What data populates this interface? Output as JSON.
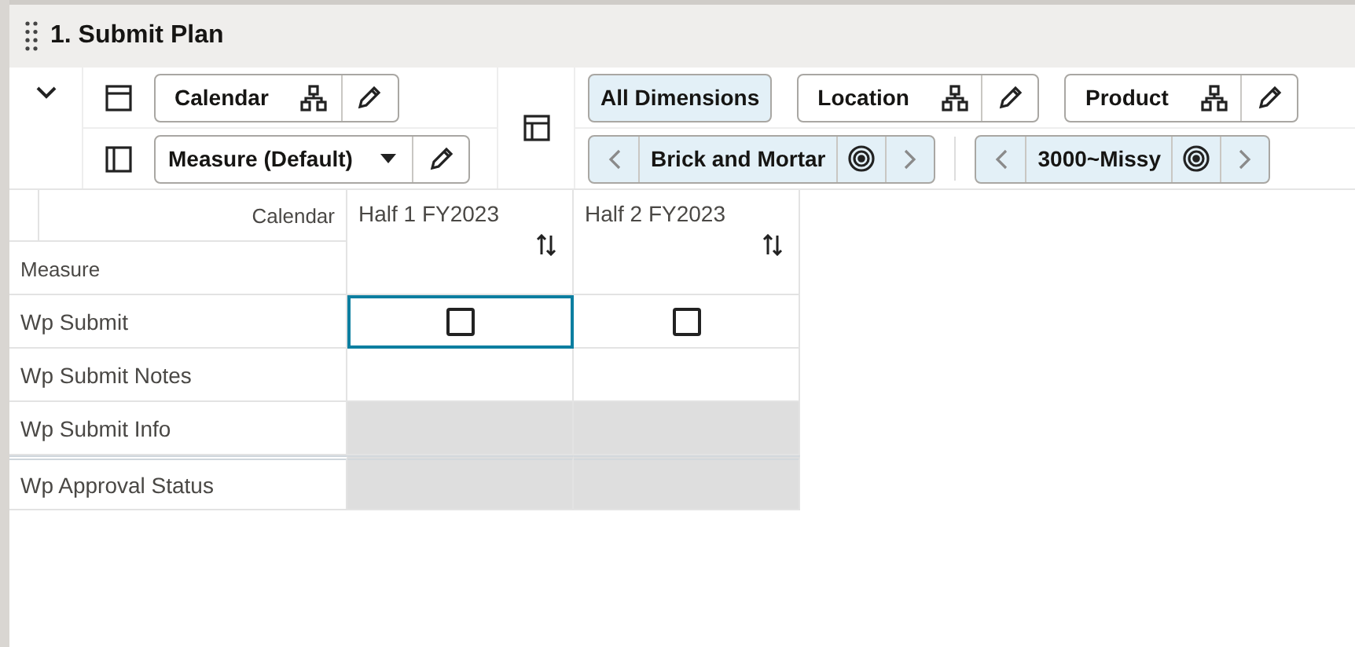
{
  "panel": {
    "title": "1. Submit Plan"
  },
  "toolbar": {
    "expanded": false,
    "column_tiles": [
      {
        "label": "Calendar",
        "kind": "hierarchy"
      }
    ],
    "row_tiles": [
      {
        "label": "Measure (Default)",
        "kind": "dropdown"
      }
    ],
    "all_dimensions": {
      "label": "All Dimensions",
      "selected": true
    },
    "page_tiles": [
      {
        "label": "Location",
        "kind": "hierarchy"
      },
      {
        "label": "Product",
        "kind": "hierarchy"
      }
    ],
    "page_selectors": [
      {
        "label": "Brick and Mortar"
      },
      {
        "label": "3000~Missy"
      }
    ]
  },
  "grid": {
    "column_dimension": "Calendar",
    "row_dimension": "Measure",
    "columns": [
      {
        "label": "Half 1 FY2023"
      },
      {
        "label": "Half 2 FY2023"
      }
    ],
    "rows": [
      {
        "label": "Wp Submit",
        "group_start": false,
        "cells": [
          {
            "kind": "checkbox",
            "checked": false,
            "selected": true
          },
          {
            "kind": "checkbox",
            "checked": false,
            "selected": false
          }
        ]
      },
      {
        "label": "Wp Submit Notes",
        "group_start": false,
        "cells": [
          {
            "kind": "editable",
            "selected": false
          },
          {
            "kind": "editable",
            "selected": false
          }
        ]
      },
      {
        "label": "Wp Submit Info",
        "group_start": false,
        "cells": [
          {
            "kind": "readonly",
            "selected": false
          },
          {
            "kind": "readonly",
            "selected": false
          }
        ]
      },
      {
        "label": "Wp Approval Status",
        "group_start": true,
        "cells": [
          {
            "kind": "readonly",
            "selected": false
          },
          {
            "kind": "readonly",
            "selected": false
          }
        ]
      }
    ]
  }
}
